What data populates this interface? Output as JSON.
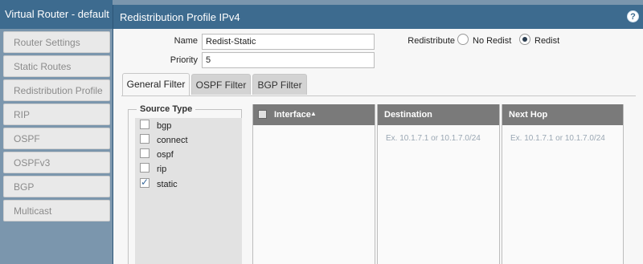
{
  "window": {
    "title": "Virtual Router - default",
    "sidebar": [
      "Router Settings",
      "Static Routes",
      "Redistribution Profile",
      "RIP",
      "OSPF",
      "OSPFv3",
      "BGP",
      "Multicast"
    ]
  },
  "dialog": {
    "title": "Redistribution Profile IPv4",
    "help_icon": "?",
    "name_label": "Name",
    "name_value": "Redist-Static",
    "priority_label": "Priority",
    "priority_value": "5",
    "redistribute_label": "Redistribute",
    "redistribute_options": [
      "No Redist",
      "Redist"
    ],
    "redistribute_selected": "Redist",
    "tabs": [
      "General Filter",
      "OSPF Filter",
      "BGP Filter"
    ],
    "active_tab": "General Filter",
    "source_type": {
      "title": "Source Type",
      "items": [
        {
          "label": "bgp",
          "checked": false
        },
        {
          "label": "connect",
          "checked": false
        },
        {
          "label": "ospf",
          "checked": false
        },
        {
          "label": "rip",
          "checked": false
        },
        {
          "label": "static",
          "checked": true
        }
      ]
    },
    "grids": {
      "interface": {
        "header": "Interface",
        "sort_icon": "▲"
      },
      "destination": {
        "header": "Destination",
        "placeholder": "Ex. 10.1.7.1 or 10.1.7.0/24"
      },
      "next_hop": {
        "header": "Next Hop",
        "placeholder": "Ex. 10.1.7.1 or 10.1.7.0/24"
      }
    }
  }
}
